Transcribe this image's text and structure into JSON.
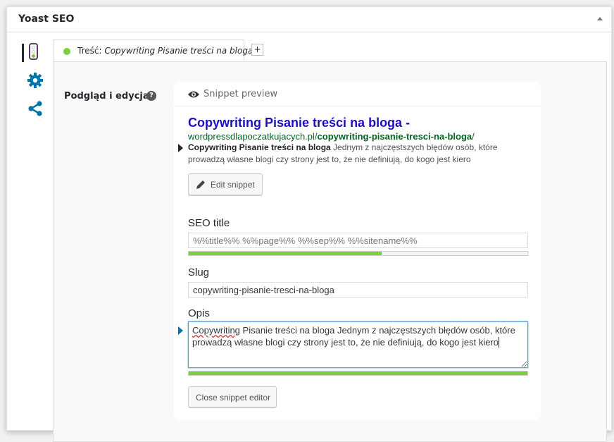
{
  "metabox": {
    "title": "Yoast SEO"
  },
  "colors": {
    "good": "#7ad03a",
    "link": "#1e0fbe",
    "url": "#006621",
    "purple": "#5f3a6b",
    "focus": "#5b9dd9"
  },
  "side_tabs": [
    {
      "name": "readability",
      "icon": "traffic-light-icon"
    },
    {
      "name": "settings",
      "icon": "gear-icon"
    },
    {
      "name": "social",
      "icon": "share-icon"
    }
  ],
  "content_tab": {
    "prefix": "Treść: ",
    "keyword": "Copywriting Pisanie treści na bloga",
    "add_label": "+"
  },
  "editor": {
    "label": "Podgląd i edycja",
    "help": "?",
    "preview_label": "Snippet preview",
    "serp": {
      "title": "Copywriting Pisanie treści na bloga -",
      "url_base": "wordpressdlapoczatkujacych.pl/",
      "url_slug": "copywriting-pisanie-tresci-na-bloga",
      "url_end": "/",
      "desc_bold": "Copywriting Pisanie treści na bloga",
      "desc_rest": " Jednym z najczęstszych błędów osób, które prowadzą własne blogi czy strony jest to, że nie definiują, do kogo jest kiero"
    },
    "edit_button": "Edit snippet",
    "seo_title_label": "SEO title",
    "seo_title_value": "%%title%% %%page%% %%sep%% %%sitename%%",
    "seo_title_progress": 0.57,
    "slug_label": "Slug",
    "slug_value": "copywriting-pisanie-tresci-na-bloga",
    "opis_label": "Opis",
    "opis_first_word": "Copywriting",
    "opis_value_rest": " Pisanie treści na bloga Jednym z najczęstszych błędów osób, które prowadzą własne blogi czy strony jest to, że nie definiują, do kogo jest kiero",
    "opis_progress": 1.0,
    "close_button": "Close snippet editor"
  }
}
